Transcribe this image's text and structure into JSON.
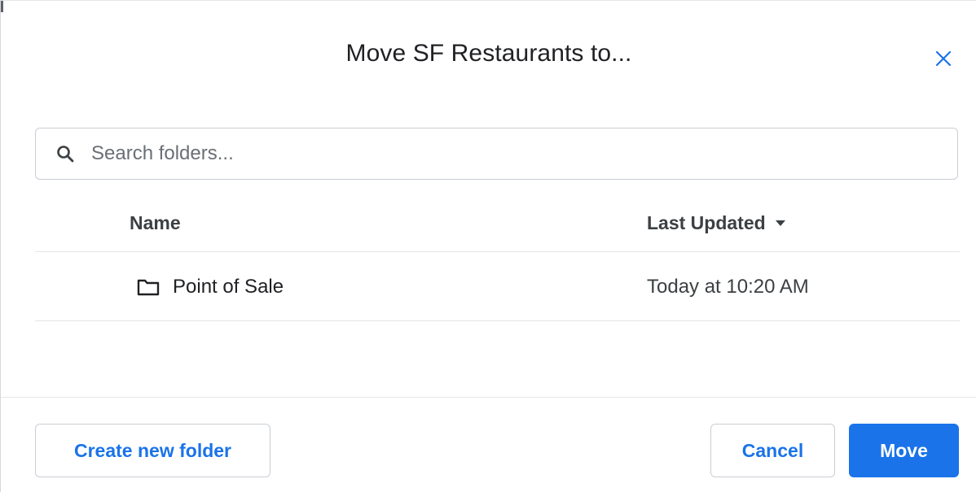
{
  "dialog": {
    "title": "Move SF Restaurants to..."
  },
  "search": {
    "placeholder": "Search folders...",
    "value": ""
  },
  "table": {
    "columns": {
      "name": "Name",
      "last_updated": "Last Updated"
    },
    "sort": {
      "column": "last_updated",
      "direction": "descending"
    },
    "rows": [
      {
        "name": "Point of Sale",
        "updated": "Today at 10:20 AM",
        "icon": "folder-icon"
      }
    ]
  },
  "footer": {
    "create_label": "Create new folder",
    "cancel_label": "Cancel",
    "move_label": "Move"
  },
  "icons": {
    "close": "close-icon",
    "search": "search-icon",
    "sort": "caret-down-icon",
    "row": "folder-icon"
  },
  "colors": {
    "accent": "#1a73e8",
    "text": "#202124",
    "border": "#c9ced4",
    "divider": "#e3e5e8"
  }
}
